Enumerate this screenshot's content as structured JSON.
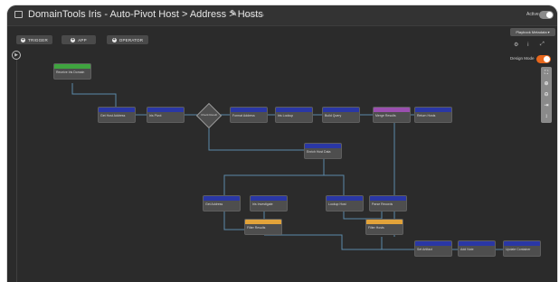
{
  "app": {
    "title": "DomainTools Iris - Auto-Pivot Host > Address > Hosts",
    "version": "version 1.10",
    "active_label": "Active",
    "active_on": true
  },
  "toolbar": {
    "trigger_label": "TRIGGER",
    "app_label": "APP",
    "operator_label": "OPERATOR"
  },
  "right_panel": {
    "playbook_dropdown": "Playbook Metadata",
    "design_mode_label": "Design Mode",
    "design_mode_on": true,
    "zoom_buttons": [
      "fit",
      "zoom-in",
      "zoom-out",
      "align",
      "reset"
    ]
  },
  "colors": {
    "canvas_bg": "#2b2b2b",
    "app_header": "#2a37a5",
    "trigger_header": "#3fa43f",
    "filter_header": "#e2a33a",
    "merge_header": "#9b4fb0",
    "toggle_accent": "#e8671c",
    "wire": "#5b8aa8"
  },
  "nodes": [
    {
      "id": "n1",
      "type": "trigger",
      "label": "Receive Iris Domain"
    },
    {
      "id": "n2",
      "type": "app",
      "label": "Get Host Address"
    },
    {
      "id": "n3",
      "type": "app",
      "label": "Iris Pivot"
    },
    {
      "id": "n4",
      "type": "app",
      "label": "Format Address"
    },
    {
      "id": "n5",
      "type": "app",
      "label": "Iris Lookup"
    },
    {
      "id": "n6",
      "type": "app",
      "label": "Build Query"
    },
    {
      "id": "n7",
      "type": "merge",
      "label": "Merge Results"
    },
    {
      "id": "n8",
      "type": "app",
      "label": "Return Hosts"
    },
    {
      "id": "n9",
      "type": "app",
      "label": "Enrich Host Data"
    },
    {
      "id": "n10",
      "type": "app",
      "label": "Get Address"
    },
    {
      "id": "n11",
      "type": "app",
      "label": "Iris Investigate"
    },
    {
      "id": "n12",
      "type": "app",
      "label": "Lookup Host"
    },
    {
      "id": "n13",
      "type": "app",
      "label": "Parse Records"
    },
    {
      "id": "n14",
      "type": "filter",
      "label": "Filter Results"
    },
    {
      "id": "n15",
      "type": "filter",
      "label": "Filter Hosts"
    },
    {
      "id": "n16",
      "type": "app",
      "label": "Set Artifact"
    },
    {
      "id": "n17",
      "type": "app",
      "label": "Add Note"
    },
    {
      "id": "n18",
      "type": "app",
      "label": "Update Container"
    }
  ],
  "decision": {
    "label": "Check Result"
  }
}
